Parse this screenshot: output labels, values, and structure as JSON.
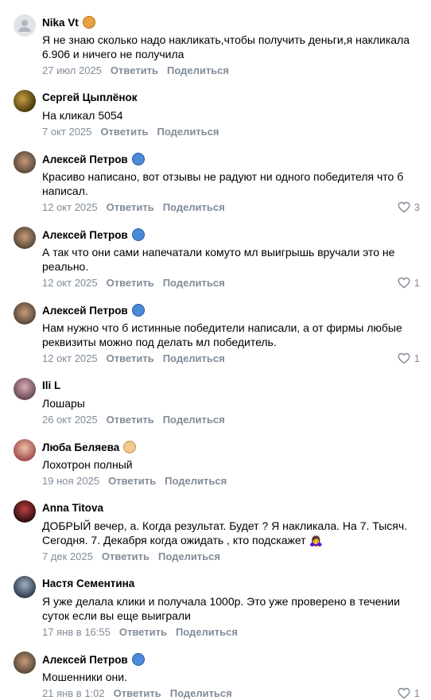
{
  "actions": {
    "reply": "Ответить",
    "share": "Поделиться"
  },
  "comments": [
    {
      "author": "Nika Vt",
      "text": "Я не знаю сколько надо накликать,чтобы получить деньги,я накликала 6.906 и ничего не получила",
      "date": "27 июл 2025",
      "likes": ""
    },
    {
      "author": "Сергей Цыплёнок",
      "text": "На кликал 5054",
      "date": "7 окт 2025",
      "likes": ""
    },
    {
      "author": "Алексей Петров",
      "text": "Красиво написано, вот отзывы не радуют ни одного победителя что б написал.",
      "date": "12 окт 2025",
      "likes": "3"
    },
    {
      "author": "Алексей Петров",
      "text": "А так что они сами напечатали комуто мл выигрышь вручали это не реально.",
      "date": "12 окт 2025",
      "likes": "1"
    },
    {
      "author": "Алексей Петров",
      "text": "Нам нужно что б истинные победители написали, а от фирмы любые реквизиты можно под делать мл победитель.",
      "date": "12 окт 2025",
      "likes": "1"
    },
    {
      "author": "Ili L",
      "text": "Лошары",
      "date": "26 окт 2025",
      "likes": ""
    },
    {
      "author": "Люба Беляева",
      "text": "Лохотрон полный",
      "date": "19 ноя 2025",
      "likes": ""
    },
    {
      "author": "Anna Titova",
      "text": "ДОБРЫЙ вечер, а. Когда результат. Будет ? Я накликала. На 7. Тысяч. Сегодня. 7. Декабря когда ожидать , кто подскажет 🙇‍♀️",
      "date": "7 дек 2025",
      "likes": ""
    },
    {
      "author": "Настя Сементина",
      "text": "Я уже делала клики и получала 1000р. Это уже проверено в течении суток если вы еще выиграли",
      "date": "17 янв в 16:55",
      "likes": ""
    },
    {
      "author": "Алексей Петров",
      "text": "Мошенники они.",
      "date": "21 янв в 1:02",
      "likes": "1"
    }
  ],
  "avatar_colors": [
    "#e1e3e6",
    "#6b5a2a",
    "#8a6a4a",
    "#8a6a4a",
    "#8a6a4a",
    "#7a5a6a",
    "#b07a7a",
    "#5a3030",
    "#405060",
    "#8a6a4a"
  ],
  "badge_icons": [
    "cookie-emoji-icon",
    "",
    "mask-emoji-icon",
    "mask-emoji-icon",
    "mask-emoji-icon",
    "",
    "girl-emoji-icon",
    "",
    "",
    "mask-emoji-icon"
  ]
}
